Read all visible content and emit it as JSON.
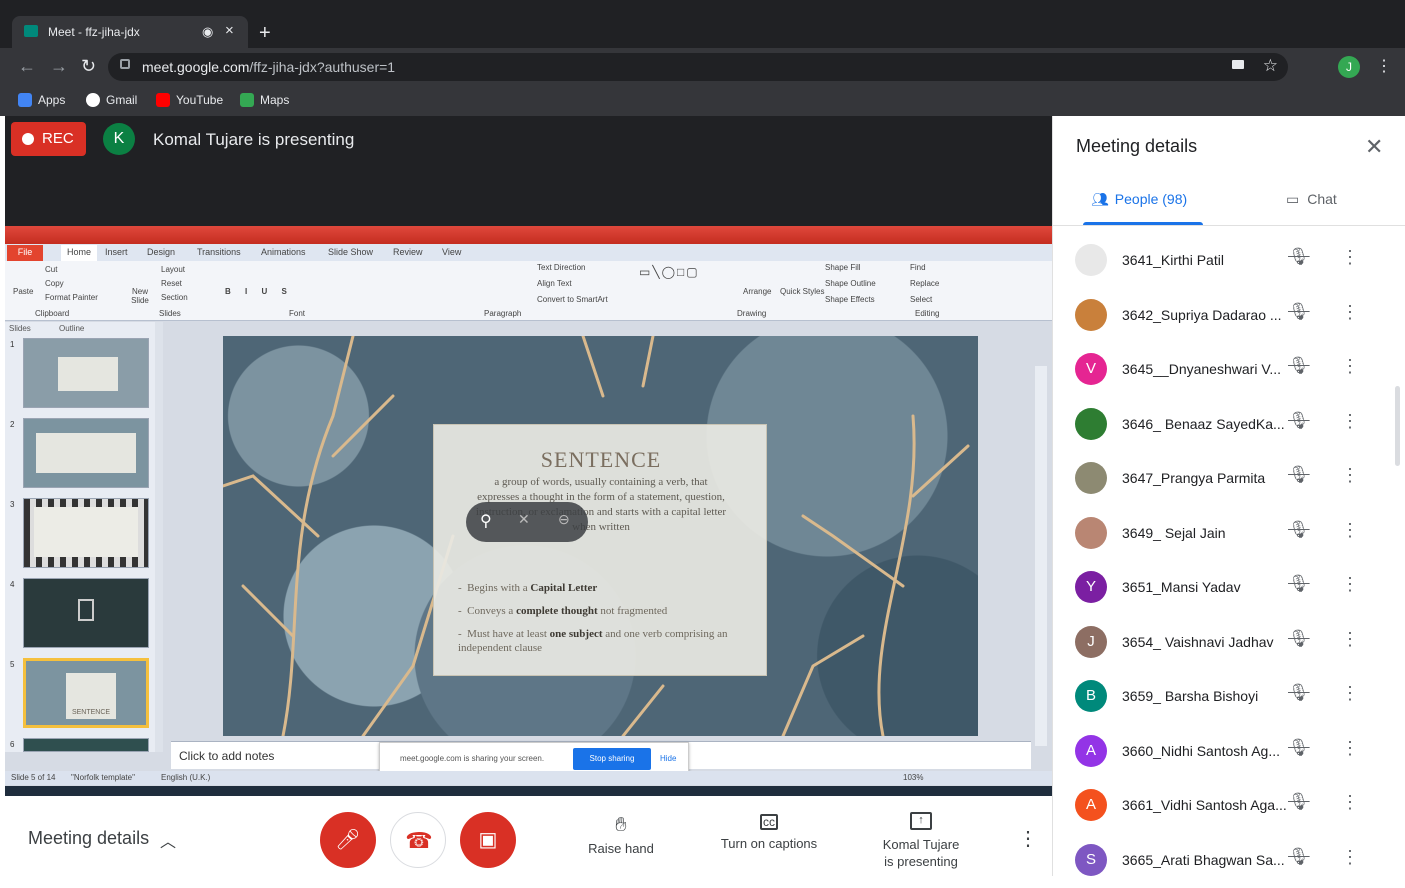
{
  "browser": {
    "tab_title": "Meet - ffz-jiha-jdx",
    "tab_close": "×",
    "new_tab": "+",
    "url_host": "meet.google.com",
    "url_path": "/ffz-jiha-jdx?authuser=1",
    "profile_initial": "J",
    "bookmarks": [
      "Apps",
      "Gmail",
      "YouTube",
      "Maps"
    ]
  },
  "stage": {
    "rec_label": "REC",
    "presenter_initial": "K",
    "presenting_text": "Komal Tujare is presenting"
  },
  "ppt": {
    "tabs": [
      "Home",
      "Insert",
      "Design",
      "Transitions",
      "Animations",
      "Slide Show",
      "Review",
      "View"
    ],
    "file_tab": "File",
    "ribbon": {
      "cut": "Cut",
      "copy": "Copy",
      "format_painter": "Format Painter",
      "paste": "Paste",
      "clipboard": "Clipboard",
      "new_slide": "New Slide",
      "layout": "Layout",
      "reset": "Reset",
      "section": "Section",
      "slides": "Slides",
      "font": "Font",
      "paragraph": "Paragraph",
      "text_direction": "Text Direction",
      "align_text": "Align Text",
      "convert_smartart": "Convert to SmartArt",
      "drawing": "Drawing",
      "arrange": "Arrange",
      "quick_styles": "Quick Styles",
      "shape_fill": "Shape Fill",
      "shape_outline": "Shape Outline",
      "shape_effects": "Shape Effects",
      "find": "Find",
      "replace": "Replace",
      "select": "Select",
      "editing": "Editing"
    },
    "panel_tabs": [
      "Slides",
      "Outline"
    ],
    "thumb_numbers": [
      "1",
      "2",
      "3",
      "4",
      "5",
      "6"
    ],
    "thumb5_label": "SENTENCE",
    "notes_placeholder": "Click to add notes",
    "status": {
      "slide_of": "Slide 5 of 14",
      "template": "\"Norfolk template\"",
      "language": "English (U.K.)",
      "zoom": "103%"
    },
    "share_bar": {
      "message": "meet.google.com is sharing your screen.",
      "stop": "Stop sharing",
      "hide": "Hide"
    },
    "slide": {
      "title": "SENTENCE",
      "definition": "a group of words, usually containing a verb, that expresses a thought in the form of a statement, question, instruction, or exclamation and starts with a capital letter when written",
      "bullets": [
        {
          "pre": "Begins with a ",
          "bold": "Capital Letter",
          "post": ""
        },
        {
          "pre": "Conveys  a ",
          "bold": "complete thought",
          "post": " not fragmented"
        },
        {
          "pre": "Must have at least ",
          "bold": "one subject",
          "post": "and one verb comprising an independent clause"
        }
      ]
    }
  },
  "bottom_bar": {
    "meeting_details": "Meeting details",
    "raise_hand": "Raise hand",
    "captions": "Turn on captions",
    "presenting_line1": "Komal Tujare",
    "presenting_line2": "is presenting"
  },
  "panel": {
    "title": "Meeting details",
    "people_tab": "People (98)",
    "chat_tab": "Chat",
    "people": [
      {
        "name": "3641_Kirthi Patil",
        "initial": "",
        "color": "#e8e8e8"
      },
      {
        "name": "3642_Supriya Dadarao ...",
        "initial": "",
        "color": "#c9803b"
      },
      {
        "name": "3645__Dnyaneshwari V...",
        "initial": "V",
        "color": "#e52592"
      },
      {
        "name": "3646_ Benaaz SayedKa...",
        "initial": "",
        "color": "#2e7d32"
      },
      {
        "name": "3647_Prangya Parmita",
        "initial": "",
        "color": "#8d8a72"
      },
      {
        "name": "3649_ Sejal Jain",
        "initial": "",
        "color": "#b98673"
      },
      {
        "name": "3651_Mansi Yadav",
        "initial": "Y",
        "color": "#7b1fa2"
      },
      {
        "name": "3654_ Vaishnavi Jadhav",
        "initial": "J",
        "color": "#8d6e63"
      },
      {
        "name": "3659_ Barsha Bishoyi",
        "initial": "B",
        "color": "#00897b"
      },
      {
        "name": "3660_Nidhi Santosh Ag...",
        "initial": "A",
        "color": "#9334e6"
      },
      {
        "name": "3661_Vidhi Santosh Aga...",
        "initial": "A",
        "color": "#f4511e"
      },
      {
        "name": "3665_Arati Bhagwan Sa...",
        "initial": "S",
        "color": "#7e57c2"
      }
    ]
  }
}
